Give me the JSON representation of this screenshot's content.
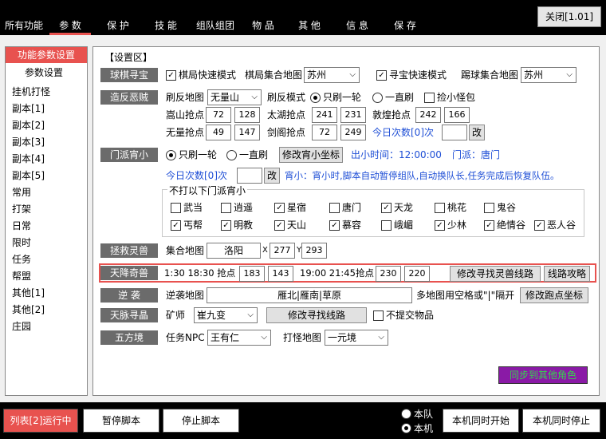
{
  "tabs": [
    "所有功能",
    "参 数",
    "保 护",
    "技 能",
    "组队组团",
    "物 品",
    "其 他",
    "信 息",
    "保 存"
  ],
  "close_label": "关闭[1.01]",
  "sidebar": {
    "header": "功能参数设置",
    "items": [
      "参数设置",
      "挂机打怪",
      "副本[1]",
      "副本[2]",
      "副本[3]",
      "副本[4]",
      "副本[5]",
      "常用",
      "打架",
      "日常",
      "限时",
      "任务",
      "帮盟",
      "其他[1]",
      "其他[2]",
      "庄园"
    ]
  },
  "section_title": "【设置区】",
  "qiuqi": {
    "label": "球棋寻宝",
    "fast_mode": "棋局快速模式",
    "map_label": "棋局集合地图",
    "map_value": "苏州",
    "treasure_fast": "寻宝快速模式",
    "kick_map_label": "踢球集合地图",
    "kick_map_value": "苏州"
  },
  "zaofan": {
    "label": "造反恶贼",
    "map_label": "刷反地图",
    "map_value": "无量山",
    "mode_label": "刷反模式",
    "once": "只刷一轮",
    "always": "一直刷",
    "pick_monster": "捡小怪包",
    "songshan": "嵩山抢点",
    "songshan_x": "72",
    "songshan_y": "128",
    "taihu": "太湖抢点",
    "taihu_x": "241",
    "taihu_y": "231",
    "dunhuang": "敦煌抢点",
    "dunhuang_x": "242",
    "dunhuang_y": "166",
    "wuliang": "无量抢点",
    "wuliang_x": "49",
    "wuliang_y": "147",
    "jiange": "剑阁抢点",
    "jiange_x": "72",
    "jiange_y": "249",
    "today": "今日次数[0]次",
    "change": "改"
  },
  "menpai": {
    "label": "门派宵小",
    "once": "只刷一轮",
    "always": "一直刷",
    "modify_btn": "修改宵小坐标",
    "time": "出小时间：12:00:00",
    "menpai": "门派：唐门",
    "today": "今日次数[0]次",
    "change": "改",
    "note": "宵小：宵小时,脚本自动暂停组队,自动换队长,任务完成后恢复队伍。",
    "group_title": "不打以下门派宵小",
    "schools": [
      {
        "name": "武当",
        "checked": false
      },
      {
        "name": "逍遥",
        "checked": false
      },
      {
        "name": "星宿",
        "checked": true
      },
      {
        "name": "唐门",
        "checked": false
      },
      {
        "name": "天龙",
        "checked": true
      },
      {
        "name": "桃花",
        "checked": false
      },
      {
        "name": "鬼谷",
        "checked": false
      },
      {
        "name": "丐帮",
        "checked": true
      },
      {
        "name": "明教",
        "checked": true
      },
      {
        "name": "天山",
        "checked": true
      },
      {
        "name": "慕容",
        "checked": true
      },
      {
        "name": "峨嵋",
        "checked": false
      },
      {
        "name": "少林",
        "checked": true
      },
      {
        "name": "绝情谷",
        "checked": true
      },
      {
        "name": "恶人谷",
        "checked": true
      }
    ]
  },
  "zhengjiu": {
    "label": "拯救灵兽",
    "map_label": "集合地图",
    "map_value": "洛阳",
    "x_label": "X",
    "x": "277",
    "y_label": "Y",
    "y": "293"
  },
  "tianjiang": {
    "label": "天降奇兽",
    "time1": "1:30 18:30 抢点",
    "a_x": "183",
    "a_y": "143",
    "time2": "19:00 21:45抢点",
    "b_x": "230",
    "b_y": "220",
    "modify_btn": "修改寻找灵兽线路",
    "guide_btn": "线路攻略"
  },
  "nixi": {
    "label": "逆  袭",
    "map_label": "逆袭地图",
    "map_value": "雁北|雁南|草原",
    "hint": "多地图用空格或\"|\"隔开",
    "modify_btn": "修改跑点坐标"
  },
  "tianmai": {
    "label": "天脉寻晶",
    "miner_label": "矿师",
    "miner_value": "崔九变",
    "modify_btn": "修改寻找线路",
    "no_submit": "不提交物品"
  },
  "wufang": {
    "label": "五方境",
    "npc_label": "任务NPC",
    "npc_value": "王有仁",
    "map_label": "打怪地图",
    "map_value": "一元境"
  },
  "sync_btn": "同步到其他角色",
  "bottom": {
    "run": "列表[2]运行中",
    "pause": "暂停脚本",
    "stop": "停止脚本",
    "team": "本队",
    "local": "本机",
    "start_all": "本机同时开始",
    "stop_all": "本机同时停止"
  }
}
